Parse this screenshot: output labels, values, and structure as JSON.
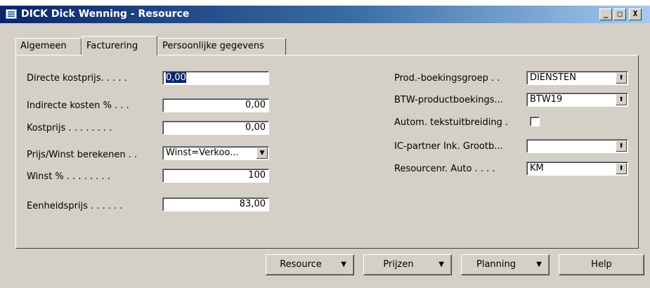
{
  "window": {
    "title": "DICK Dick Wenning - Resource",
    "controls": {
      "minimize": "_",
      "restore": "□",
      "close": "X"
    }
  },
  "tabs": [
    {
      "label": "Algemeen",
      "active": false
    },
    {
      "label": "Facturering",
      "active": true
    },
    {
      "label": "Persoonlijke gegevens",
      "active": false
    }
  ],
  "left_fields": {
    "directe_kostprijs": {
      "label": "Directe kostprijs. . . . .",
      "value": "0,00"
    },
    "indirecte_kosten": {
      "label": "Indirecte kosten % . . .",
      "value": "0,00"
    },
    "kostprijs": {
      "label": "Kostprijs . . . . . . . .",
      "value": "0,00"
    },
    "prijs_winst": {
      "label": "Prijs/Winst berekenen . .",
      "value": "Winst=Verkoo..."
    },
    "winst": {
      "label": "Winst % . . . . . . . .",
      "value": "100"
    },
    "eenheidsprijs": {
      "label": "Eenheidsprijs . . . . . .",
      "value": "83,00"
    }
  },
  "right_fields": {
    "prod_boekingsgroep": {
      "label": "Prod.-boekingsgroep . .",
      "value": "DIENSTEN"
    },
    "btw_productboekings": {
      "label": "BTW-productboekings...",
      "value": "BTW19"
    },
    "autom_tekst": {
      "label": "Autom. tekstuitbreiding .",
      "checked": false
    },
    "ic_partner": {
      "label": "IC-partner Ink. Grootb...",
      "value": ""
    },
    "resourcenr_auto": {
      "label": "Resourcenr. Auto . . . .",
      "value": "KM"
    }
  },
  "buttons": {
    "resource": "Resource",
    "prijzen": "Prijzen",
    "planning": "Planning",
    "help": "Help"
  },
  "glyphs": {
    "dropdown_arrow": "▼",
    "lookup_arrow": "⬆"
  }
}
